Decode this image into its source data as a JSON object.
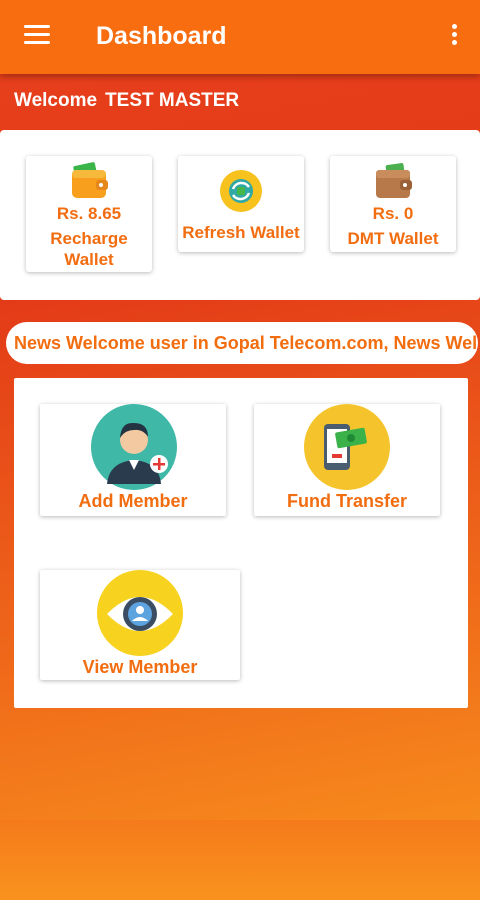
{
  "appbar": {
    "title": "Dashboard",
    "menu_icon": "hamburger-menu-icon",
    "more_icon": "more-vert-icon"
  },
  "welcome": {
    "label": "Welcome",
    "name": "TEST MASTER"
  },
  "wallets": [
    {
      "amount": "Rs.  8.65",
      "label_line1": "Recharge",
      "label_line2": "Wallet",
      "icon": "wallet-icon"
    },
    {
      "amount": "",
      "label_line1": "Refresh Wallet",
      "label_line2": "",
      "icon": "refresh-icon"
    },
    {
      "amount": "Rs.  0",
      "label_line1": "DMT Wallet",
      "label_line2": "",
      "icon": "wallet-icon"
    }
  ],
  "news": {
    "text": "News Welcome user in Gopal Telecom.com, News Wel.."
  },
  "menu": [
    {
      "label": "Add Member",
      "icon": "add-member-icon"
    },
    {
      "label": "Fund Transfer",
      "icon": "fund-transfer-icon"
    },
    {
      "label": "View Member",
      "icon": "view-member-icon"
    }
  ],
  "colors": {
    "primary": "#f76d10",
    "accent_text": "#f26d10",
    "gradient_top": "#e8411c",
    "gradient_bottom": "#f9951d"
  }
}
